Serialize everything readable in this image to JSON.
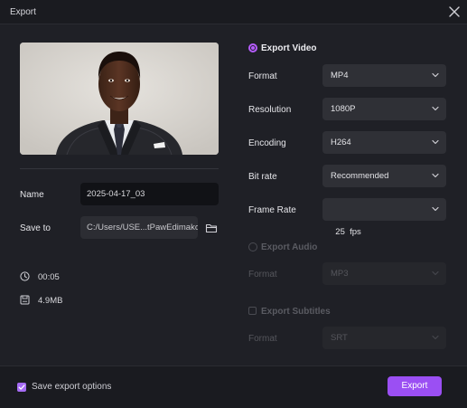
{
  "window": {
    "title": "Export"
  },
  "left": {
    "name_label": "Name",
    "name_value": "2025-04-17_03",
    "save_to_label": "Save to",
    "save_to_value": "C:/Users/USE...tPawEdimakor",
    "duration": "00:05",
    "file_size": "4.9MB",
    "icons": {
      "duration": "clock-icon",
      "size": "file-size-icon",
      "folder": "folder-icon"
    }
  },
  "export_video": {
    "title": "Export Video",
    "selected": true,
    "rows": [
      {
        "label": "Format",
        "value": "MP4"
      },
      {
        "label": "Resolution",
        "value": "1080P"
      },
      {
        "label": "Encoding",
        "value": "H264"
      },
      {
        "label": "Bit rate",
        "value": "Recommended"
      },
      {
        "label": "Frame Rate",
        "value": "25  fps"
      }
    ]
  },
  "export_audio": {
    "title": "Export Audio",
    "selected": false,
    "format_label": "Format",
    "format_value": "MP3"
  },
  "export_subtitles": {
    "title": "Export Subtitles",
    "checked": false,
    "format_label": "Format",
    "format_value": "SRT"
  },
  "footer": {
    "save_options_label": "Save export options",
    "save_options_checked": true,
    "export_label": "Export"
  },
  "colors": {
    "accent": "#9b4ff3",
    "background": "#1f2026",
    "titlebar": "#1a1b20",
    "disabled_text": "#55565c"
  }
}
